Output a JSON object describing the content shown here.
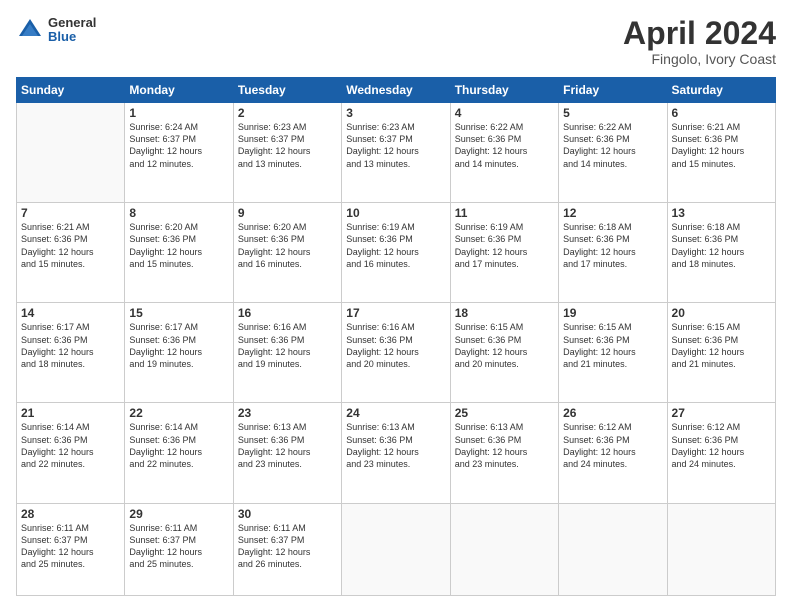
{
  "logo": {
    "general": "General",
    "blue": "Blue"
  },
  "header": {
    "title": "April 2024",
    "subtitle": "Fingolo, Ivory Coast"
  },
  "columns": [
    "Sunday",
    "Monday",
    "Tuesday",
    "Wednesday",
    "Thursday",
    "Friday",
    "Saturday"
  ],
  "weeks": [
    [
      {
        "day": "",
        "info": ""
      },
      {
        "day": "1",
        "info": "Sunrise: 6:24 AM\nSunset: 6:37 PM\nDaylight: 12 hours\nand 12 minutes."
      },
      {
        "day": "2",
        "info": "Sunrise: 6:23 AM\nSunset: 6:37 PM\nDaylight: 12 hours\nand 13 minutes."
      },
      {
        "day": "3",
        "info": "Sunrise: 6:23 AM\nSunset: 6:37 PM\nDaylight: 12 hours\nand 13 minutes."
      },
      {
        "day": "4",
        "info": "Sunrise: 6:22 AM\nSunset: 6:36 PM\nDaylight: 12 hours\nand 14 minutes."
      },
      {
        "day": "5",
        "info": "Sunrise: 6:22 AM\nSunset: 6:36 PM\nDaylight: 12 hours\nand 14 minutes."
      },
      {
        "day": "6",
        "info": "Sunrise: 6:21 AM\nSunset: 6:36 PM\nDaylight: 12 hours\nand 15 minutes."
      }
    ],
    [
      {
        "day": "7",
        "info": "Sunrise: 6:21 AM\nSunset: 6:36 PM\nDaylight: 12 hours\nand 15 minutes."
      },
      {
        "day": "8",
        "info": "Sunrise: 6:20 AM\nSunset: 6:36 PM\nDaylight: 12 hours\nand 15 minutes."
      },
      {
        "day": "9",
        "info": "Sunrise: 6:20 AM\nSunset: 6:36 PM\nDaylight: 12 hours\nand 16 minutes."
      },
      {
        "day": "10",
        "info": "Sunrise: 6:19 AM\nSunset: 6:36 PM\nDaylight: 12 hours\nand 16 minutes."
      },
      {
        "day": "11",
        "info": "Sunrise: 6:19 AM\nSunset: 6:36 PM\nDaylight: 12 hours\nand 17 minutes."
      },
      {
        "day": "12",
        "info": "Sunrise: 6:18 AM\nSunset: 6:36 PM\nDaylight: 12 hours\nand 17 minutes."
      },
      {
        "day": "13",
        "info": "Sunrise: 6:18 AM\nSunset: 6:36 PM\nDaylight: 12 hours\nand 18 minutes."
      }
    ],
    [
      {
        "day": "14",
        "info": "Sunrise: 6:17 AM\nSunset: 6:36 PM\nDaylight: 12 hours\nand 18 minutes."
      },
      {
        "day": "15",
        "info": "Sunrise: 6:17 AM\nSunset: 6:36 PM\nDaylight: 12 hours\nand 19 minutes."
      },
      {
        "day": "16",
        "info": "Sunrise: 6:16 AM\nSunset: 6:36 PM\nDaylight: 12 hours\nand 19 minutes."
      },
      {
        "day": "17",
        "info": "Sunrise: 6:16 AM\nSunset: 6:36 PM\nDaylight: 12 hours\nand 20 minutes."
      },
      {
        "day": "18",
        "info": "Sunrise: 6:15 AM\nSunset: 6:36 PM\nDaylight: 12 hours\nand 20 minutes."
      },
      {
        "day": "19",
        "info": "Sunrise: 6:15 AM\nSunset: 6:36 PM\nDaylight: 12 hours\nand 21 minutes."
      },
      {
        "day": "20",
        "info": "Sunrise: 6:15 AM\nSunset: 6:36 PM\nDaylight: 12 hours\nand 21 minutes."
      }
    ],
    [
      {
        "day": "21",
        "info": "Sunrise: 6:14 AM\nSunset: 6:36 PM\nDaylight: 12 hours\nand 22 minutes."
      },
      {
        "day": "22",
        "info": "Sunrise: 6:14 AM\nSunset: 6:36 PM\nDaylight: 12 hours\nand 22 minutes."
      },
      {
        "day": "23",
        "info": "Sunrise: 6:13 AM\nSunset: 6:36 PM\nDaylight: 12 hours\nand 23 minutes."
      },
      {
        "day": "24",
        "info": "Sunrise: 6:13 AM\nSunset: 6:36 PM\nDaylight: 12 hours\nand 23 minutes."
      },
      {
        "day": "25",
        "info": "Sunrise: 6:13 AM\nSunset: 6:36 PM\nDaylight: 12 hours\nand 23 minutes."
      },
      {
        "day": "26",
        "info": "Sunrise: 6:12 AM\nSunset: 6:36 PM\nDaylight: 12 hours\nand 24 minutes."
      },
      {
        "day": "27",
        "info": "Sunrise: 6:12 AM\nSunset: 6:36 PM\nDaylight: 12 hours\nand 24 minutes."
      }
    ],
    [
      {
        "day": "28",
        "info": "Sunrise: 6:11 AM\nSunset: 6:37 PM\nDaylight: 12 hours\nand 25 minutes."
      },
      {
        "day": "29",
        "info": "Sunrise: 6:11 AM\nSunset: 6:37 PM\nDaylight: 12 hours\nand 25 minutes."
      },
      {
        "day": "30",
        "info": "Sunrise: 6:11 AM\nSunset: 6:37 PM\nDaylight: 12 hours\nand 26 minutes."
      },
      {
        "day": "",
        "info": ""
      },
      {
        "day": "",
        "info": ""
      },
      {
        "day": "",
        "info": ""
      },
      {
        "day": "",
        "info": ""
      }
    ]
  ]
}
